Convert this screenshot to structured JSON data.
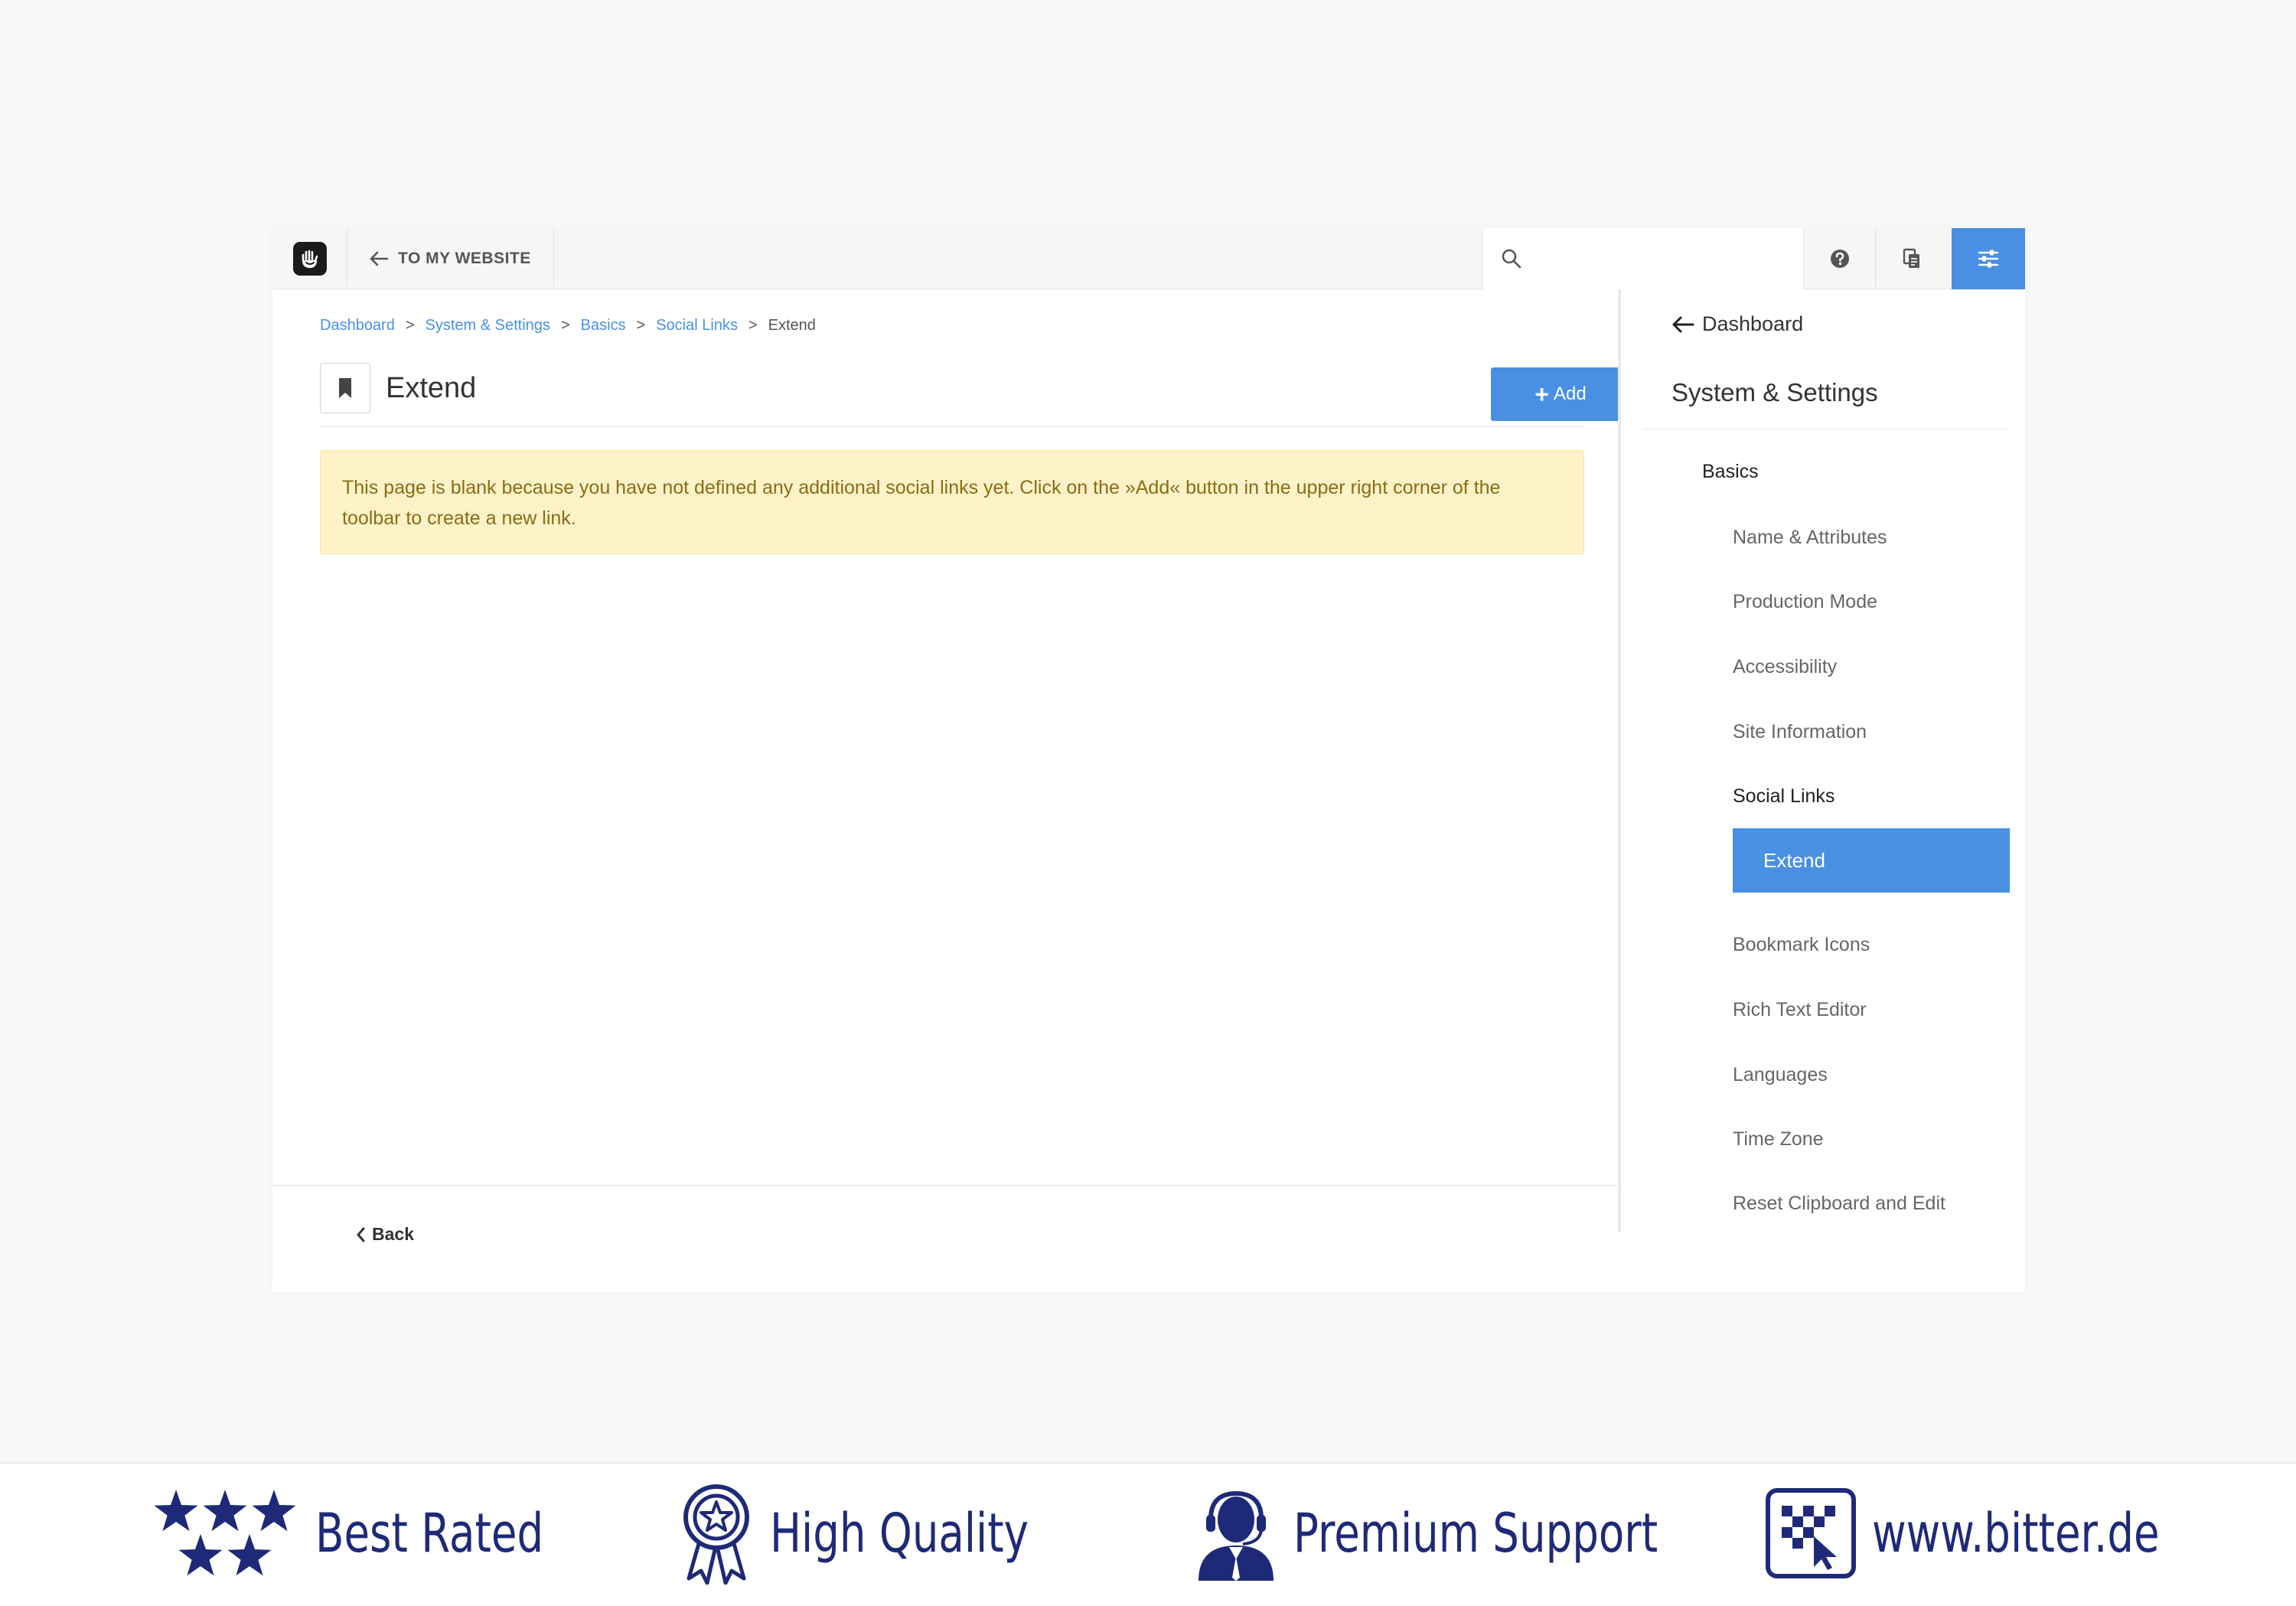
{
  "toolbar": {
    "back_label": "TO MY WEBSITE",
    "search_placeholder": ""
  },
  "breadcrumb": {
    "items": [
      "Dashboard",
      "System & Settings",
      "Basics",
      "Social Links"
    ],
    "separator": ">",
    "current": "Extend"
  },
  "page": {
    "title": "Extend",
    "add_label": "Add",
    "alert_text": "This page is blank because you have not defined any additional social links yet. Click on the »Add« button in the upper right corner of the toolbar to create a new link.",
    "back_label": "Back"
  },
  "panel": {
    "back_label": "Dashboard",
    "title": "System & Settings",
    "section": "Basics",
    "items": [
      "Name & Attributes",
      "Production Mode",
      "Accessibility",
      "Site Information",
      "Social Links",
      "Extend",
      "Bookmark Icons",
      "Rich Text Editor",
      "Languages",
      "Time Zone",
      "Reset Clipboard and Edit"
    ]
  },
  "badges": [
    {
      "label": "Best Rated",
      "icon": "stars-icon"
    },
    {
      "label": "High Quality",
      "icon": "award-ribbon-icon"
    },
    {
      "label": "Premium Support",
      "icon": "support-agent-icon"
    },
    {
      "label": "www.bitter.de",
      "icon": "bitter-logo-icon"
    }
  ],
  "colors": {
    "accent": "#4a90e2",
    "alert_bg": "#fef2c8",
    "alert_text": "#8a6d14",
    "badge_blue": "#1e2a78"
  }
}
